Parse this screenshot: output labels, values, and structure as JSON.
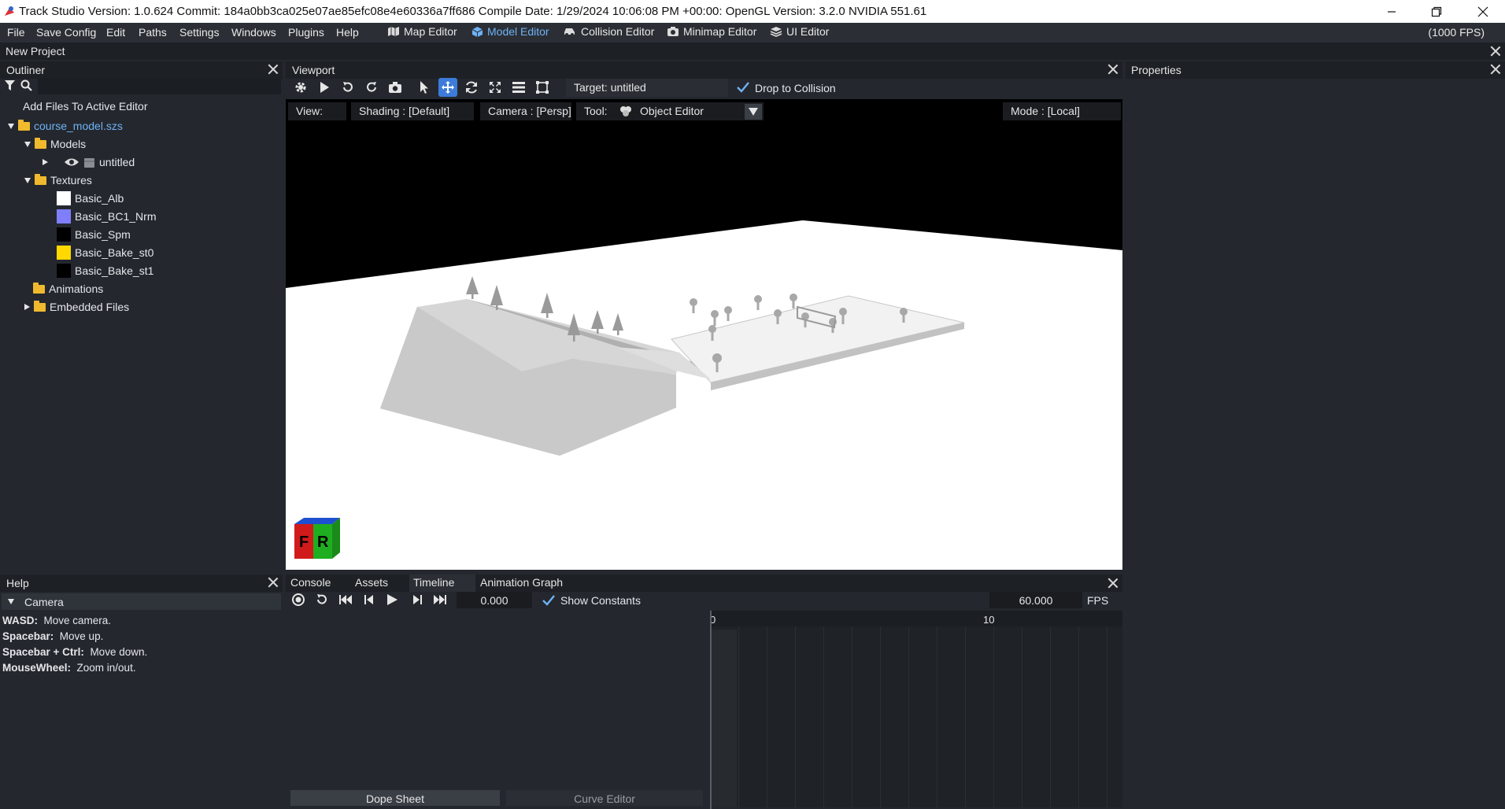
{
  "window": {
    "title": "Track Studio Version: 1.0.624 Commit: 184a0bb3ca025e07ae85efc08e4e60336a7ff686 Compile Date: 1/29/2024 10:06:08 PM +00:00: OpenGL Version: 3.2.0 NVIDIA 551.61"
  },
  "menu": {
    "items": [
      "File",
      "Save Config",
      "Edit",
      "Paths",
      "Settings",
      "Windows",
      "Plugins",
      "Help"
    ],
    "editors": [
      "Map Editor",
      "Model Editor",
      "Collision Editor",
      "Minimap Editor",
      "UI Editor"
    ],
    "active_editor": "Model Editor",
    "fps": "(1000 FPS)"
  },
  "project": {
    "name": "New Project"
  },
  "outliner": {
    "title": "Outliner",
    "add_files": "Add Files To Active Editor",
    "root": "course_model.szs",
    "models_folder": "Models",
    "model_item": "untitled",
    "textures_folder": "Textures",
    "textures": [
      {
        "name": "Basic_Alb",
        "color": "#ffffff"
      },
      {
        "name": "Basic_BC1_Nrm",
        "color": "#7f7ffe"
      },
      {
        "name": "Basic_Spm",
        "color": "#000000"
      },
      {
        "name": "Basic_Bake_st0",
        "color": "#ffd800"
      },
      {
        "name": "Basic_Bake_st1",
        "color": "#000000"
      }
    ],
    "animations_folder": "Animations",
    "embedded_folder": "Embedded Files"
  },
  "viewport": {
    "title": "Viewport",
    "target": "Target: untitled",
    "drop_to_collision": "Drop to Collision",
    "view_label": "View:",
    "shading": "Shading : [Default]",
    "camera": "Camera : [Persp]",
    "tool_label": "Tool:",
    "tool_value": "Object Editor",
    "mode": "Mode : [Local]",
    "gizmo_letters": [
      "F",
      "R"
    ]
  },
  "properties": {
    "title": "Properties"
  },
  "help": {
    "title": "Help",
    "section": "Camera",
    "lines": [
      {
        "key": "WASD:",
        "desc": "Move camera."
      },
      {
        "key": "Spacebar:",
        "desc": "Move up."
      },
      {
        "key": "Spacebar + Ctrl:",
        "desc": "Move down."
      },
      {
        "key": "MouseWheel:",
        "desc": "Zoom in/out."
      }
    ]
  },
  "bottom": {
    "tabs": [
      "Console",
      "Assets",
      "Timeline",
      "Animation Graph"
    ],
    "frame_value": "0.000",
    "show_constants": "Show Constants",
    "fps_value": "60.000",
    "fps_label": "FPS",
    "ruler_labels": [
      "0",
      "10"
    ],
    "dope_sheet": "Dope Sheet",
    "curve_editor": "Curve Editor"
  },
  "colors": {
    "accent": "#3d7bdb",
    "active_tab_text": "#6fb2f5",
    "panel_bg": "#24282e",
    "header_bg": "#1d2025"
  }
}
